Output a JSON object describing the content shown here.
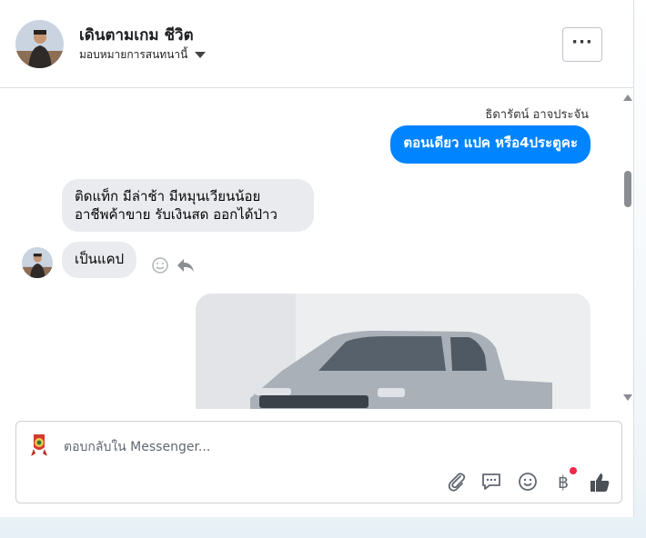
{
  "header": {
    "name": "เดินตามเกม ชีวิต",
    "subtitle": "มอบหมายการสนทนานี้",
    "more_label": "···"
  },
  "messages": {
    "sender_name": "ธิดารัตน์ อาจประจัน",
    "outgoing": "ตอนเดียว แปค หรือ4ประตูคะ",
    "incoming_1": [
      "ติดแท็ก  มีล่าช้า  มีหมุนเวียนน้อย",
      "อาชีพค้าขาย  รับเงินสด ออกได้ป่าว"
    ],
    "incoming_2": "เป็นแคป"
  },
  "composer": {
    "placeholder": "ตอบกลับใน Messenger...",
    "baht_symbol": "฿"
  },
  "colors": {
    "accent": "#0084ff",
    "incoming_bubble": "#e9ebee",
    "notification_dot": "#f02849"
  },
  "icons": [
    "more-icon",
    "caret-down-icon",
    "smile-react-icon",
    "reply-icon",
    "attach-icon",
    "gif-icon",
    "emoji-icon",
    "baht-icon",
    "thumbs-up-icon"
  ]
}
